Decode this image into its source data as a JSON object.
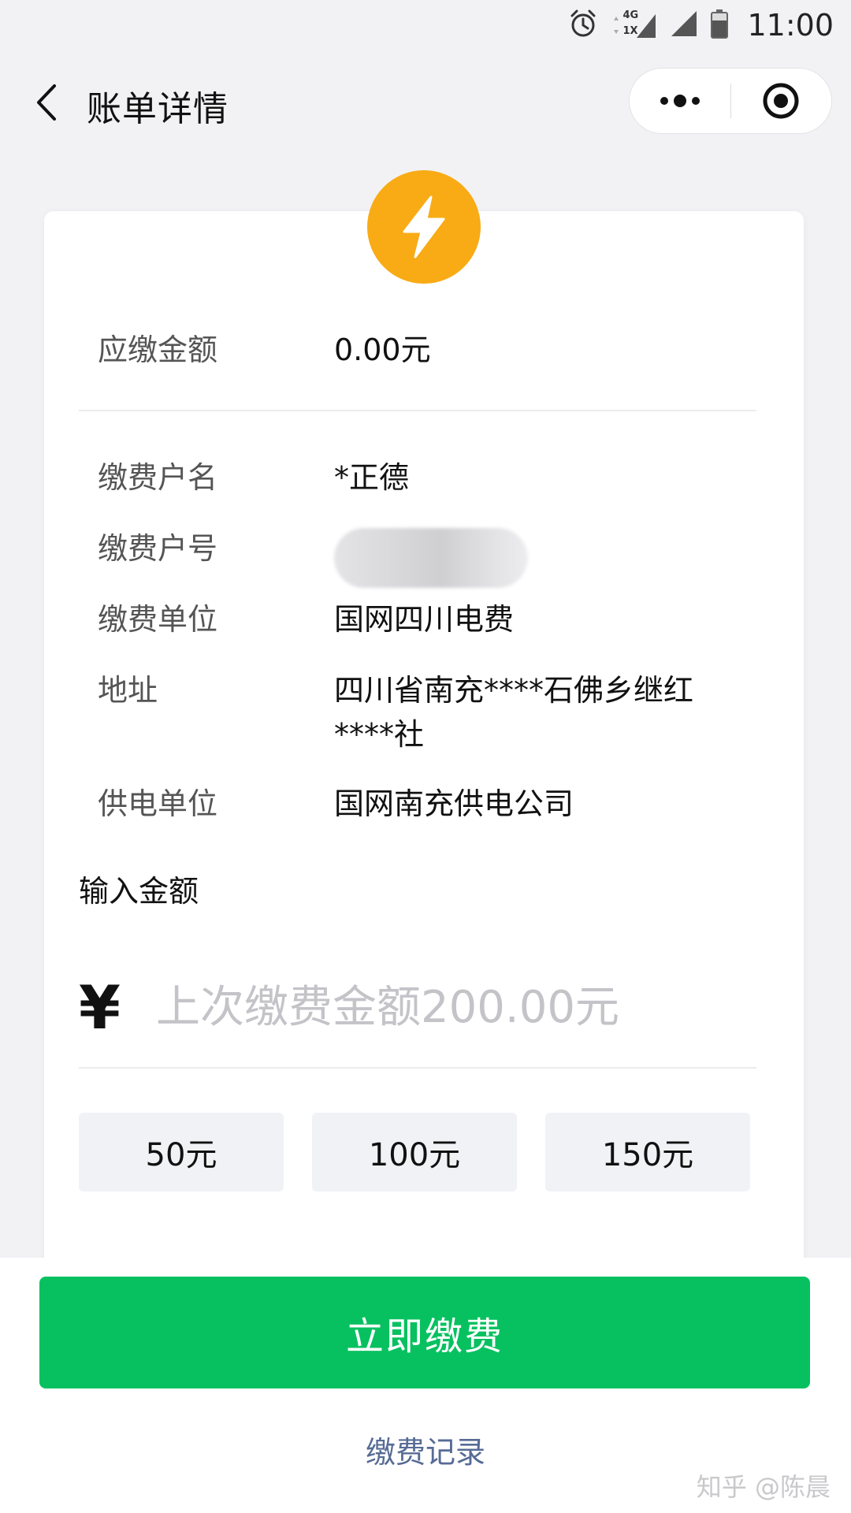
{
  "status_bar": {
    "time": "11:00",
    "network_label_top": "4G",
    "network_label_bottom": "1X",
    "icons": [
      "alarm-icon",
      "network-icon",
      "signal-icon",
      "battery-icon"
    ]
  },
  "nav": {
    "title": "账单详情",
    "icons": [
      "back-arrow-icon",
      "more-dots-icon",
      "capsule-close-icon"
    ]
  },
  "bill": {
    "icon": "lightning-bolt-icon",
    "brand_color": "#f8ab15",
    "amount_due_label": "应缴金额",
    "amount_due_value": "0.00元",
    "info": [
      {
        "label": "缴费户名",
        "value": "*正德"
      },
      {
        "label": "缴费户号",
        "value": ""
      },
      {
        "label": "缴费单位",
        "value": "国网四川电费"
      },
      {
        "label": "地址",
        "value": "四川省南充****石佛乡继红\n****社"
      },
      {
        "label": "供电单位",
        "value": "国网南充供电公司"
      }
    ]
  },
  "payment": {
    "input_label": "输入金额",
    "currency_symbol": "¥",
    "input_value": "",
    "input_placeholder": "上次缴费金额200.00元",
    "quick_amounts": [
      "50元",
      "100元",
      "150元"
    ]
  },
  "actions": {
    "pay_button_label": "立即缴费",
    "pay_button_color": "#07c160",
    "record_link_label": "缴费记录",
    "link_color": "#576b95"
  },
  "watermark": "知乎 @陈晨"
}
